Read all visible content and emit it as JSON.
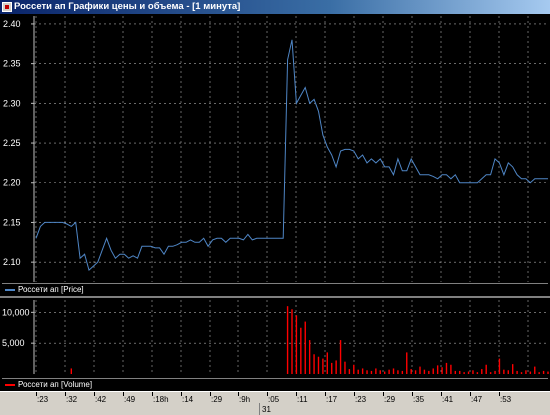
{
  "window": {
    "title": "Россети ап Графики цены и объема - [1 минута]"
  },
  "colors": {
    "price": "#4f86c6",
    "volume": "#ff0000",
    "grid": "#aaaaaa"
  },
  "legend": {
    "price": "Россети ап [Price]",
    "volume": "Россети ап [Volume]"
  },
  "chart_data": [
    {
      "type": "line",
      "name": "price",
      "ylim": [
        2.075,
        2.41
      ],
      "yticks": [
        "2.10",
        "2.15",
        "2.20",
        "2.25",
        "2.30",
        "2.35",
        "2.40"
      ],
      "grid": true,
      "series": [
        {
          "name": "Россети ап [Price]",
          "values": [
            2.13,
            2.145,
            2.15,
            2.15,
            2.15,
            2.15,
            2.15,
            2.148,
            2.145,
            2.15,
            2.105,
            2.11,
            2.09,
            2.095,
            2.1,
            2.115,
            2.13,
            2.115,
            2.105,
            2.11,
            2.11,
            2.105,
            2.108,
            2.105,
            2.12,
            2.12,
            2.12,
            2.118,
            2.118,
            2.11,
            2.12,
            2.12,
            2.122,
            2.125,
            2.125,
            2.128,
            2.125,
            2.125,
            2.13,
            2.12,
            2.128,
            2.13,
            2.13,
            2.125,
            2.13,
            2.13,
            2.13,
            2.128,
            2.135,
            2.128,
            2.13,
            2.13,
            2.13,
            2.13,
            2.13,
            2.13,
            2.13,
            2.355,
            2.38,
            2.3,
            2.31,
            2.32,
            2.3,
            2.305,
            2.29,
            2.26,
            2.245,
            2.235,
            2.22,
            2.24,
            2.242,
            2.242,
            2.24,
            2.23,
            2.235,
            2.225,
            2.23,
            2.225,
            2.23,
            2.22,
            2.22,
            2.21,
            2.23,
            2.215,
            2.215,
            2.23,
            2.22,
            2.21,
            2.21,
            2.21,
            2.208,
            2.205,
            2.21,
            2.21,
            2.205,
            2.21,
            2.2,
            2.2,
            2.2,
            2.2,
            2.2,
            2.205,
            2.21,
            2.21,
            2.23,
            2.225,
            2.21,
            2.225,
            2.22,
            2.21,
            2.205,
            2.205,
            2.2,
            2.205,
            2.205,
            2.205,
            2.205
          ]
        }
      ]
    },
    {
      "type": "bar",
      "name": "volume",
      "ylim": [
        0,
        12000
      ],
      "yticks": [
        "5,000",
        "10,000"
      ],
      "grid": true,
      "series": [
        {
          "name": "Россети ап [Volume]",
          "values": [
            0,
            0,
            0,
            0,
            0,
            0,
            0,
            0,
            900,
            0,
            0,
            0,
            0,
            0,
            0,
            0,
            0,
            0,
            0,
            0,
            0,
            0,
            0,
            0,
            0,
            0,
            0,
            0,
            0,
            0,
            0,
            0,
            0,
            0,
            0,
            0,
            0,
            0,
            0,
            0,
            0,
            0,
            0,
            0,
            0,
            0,
            0,
            0,
            0,
            0,
            0,
            0,
            0,
            0,
            0,
            0,
            0,
            11000,
            10500,
            9500,
            7500,
            8500,
            5500,
            3200,
            2800,
            2500,
            3500,
            1800,
            2200,
            5500,
            2000,
            800,
            1500,
            700,
            900,
            600,
            500,
            900,
            600,
            400,
            700,
            900,
            600,
            500,
            3500,
            800,
            600,
            1200,
            700,
            500,
            900,
            1400,
            1100,
            1800,
            1500,
            500,
            500,
            300,
            400,
            600,
            300,
            800,
            1500,
            300,
            500,
            2500,
            700,
            600,
            1600,
            500,
            300,
            600,
            400,
            1200,
            300,
            500,
            400
          ]
        }
      ]
    }
  ],
  "time_axis": {
    "labels": [
      ":23",
      ":32",
      ":42",
      ":49",
      ":18h",
      ":14",
      ":29",
      ":9h",
      ":05",
      ":11",
      ":17",
      ":23",
      ":29",
      ":35",
      ":41",
      ":47",
      ":53"
    ],
    "day_label": "31"
  }
}
